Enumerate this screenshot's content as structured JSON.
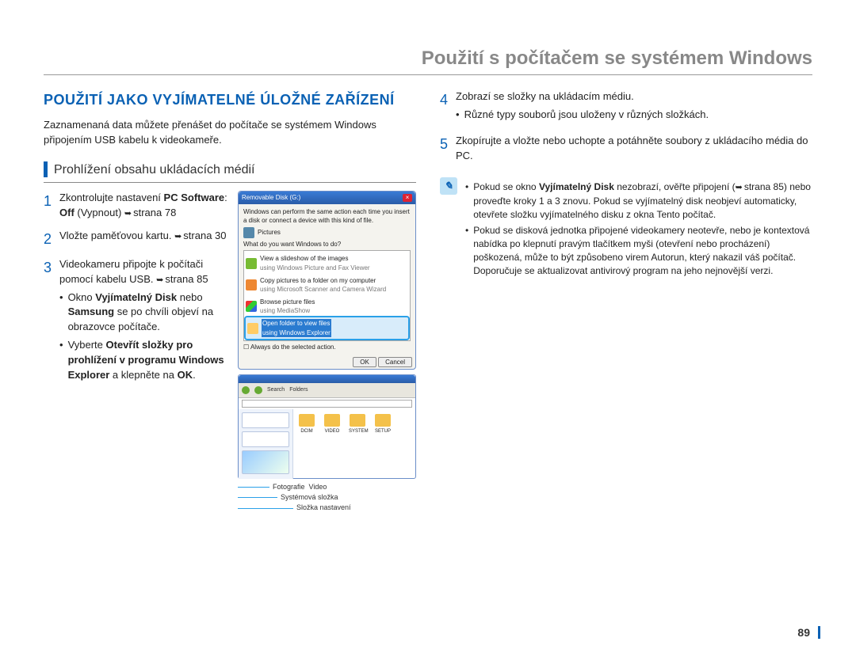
{
  "page_title": "Použití s počítačem se systémem Windows",
  "section_heading": "POUŽITÍ JAKO VYJÍMATELNÉ ÚLOŽNÉ ZAŘÍZENÍ",
  "intro": "Zaznamenaná data můžete přenášet do počítače se systémem Windows připojením USB kabelu k videokameře.",
  "sub_heading": "Prohlížení obsahu ukládacích médií",
  "steps_left": {
    "s1_a": "Zkontrolujte nastavení ",
    "s1_b": "PC Software",
    "s1_c": ": ",
    "s1_d": "Off",
    "s1_e": " (Vypnout) ",
    "s1_ref": "strana 78",
    "s2_a": "Vložte paměťovou kartu. ",
    "s2_ref": "strana 30",
    "s3_a": "Videokameru připojte k počítači pomocí kabelu USB. ",
    "s3_ref": "strana 85",
    "s3_b1_a": "Okno ",
    "s3_b1_b": "Vyjímatelný Disk",
    "s3_b1_c": " nebo ",
    "s3_b1_d": "Samsung",
    "s3_b1_e": " se po chvíli objeví na obrazovce počítače.",
    "s3_b2_a": "Vyberte ",
    "s3_b2_b": "Otevřít složky pro prohlížení v programu Windows Explorer",
    "s3_b2_c": " a klepněte na ",
    "s3_b2_d": "OK",
    "s3_b2_e": "."
  },
  "dialog": {
    "title": "Removable Disk (G:)",
    "info1": "Windows can perform the same action each time you insert a disk or connect a device with this kind of file.",
    "pic_label": "Pictures",
    "prompt": "What do you want Windows to do?",
    "opt1_a": "View a slideshow of the images",
    "opt1_b": "using Windows Picture and Fax Viewer",
    "opt2_a": "Copy pictures to a folder on my computer",
    "opt2_b": "using Microsoft Scanner and Camera Wizard",
    "opt3_a": "Browse picture files",
    "opt3_b": "using MediaShow",
    "opt4_a": "Open folder to view files",
    "opt4_b": "using Windows Explorer",
    "check": "Always do the selected action.",
    "ok": "OK",
    "cancel": "Cancel"
  },
  "explorer": {
    "toolbar_search": "Search",
    "toolbar_folders": "Folders",
    "folders": [
      "DCIM",
      "VIDEO",
      "SYSTEM",
      "SETUP"
    ]
  },
  "callouts": {
    "c1": "Fotografie",
    "c2": "Video",
    "c3": "Systémová složka",
    "c4": "Složka nastavení"
  },
  "steps_right": {
    "s4_a": "Zobrazí se složky na ukládacím médiu.",
    "s4_b1": "Různé typy souborů jsou uloženy v různých složkách.",
    "s5_a": "Zkopírujte a vložte nebo uchopte a potáhněte soubory z ukládacího média do PC."
  },
  "note": {
    "n1_a": "Pokud se okno ",
    "n1_b": "Vyjímatelný Disk",
    "n1_c": " nezobrazí, ověřte připojení (",
    "n1_ref": "strana 85",
    "n1_d": ") nebo proveďte kroky 1 a 3 znovu. Pokud se vyjímatelný disk neobjeví automaticky, otevřete složku vyjímatelného disku z okna Tento počítač.",
    "n2": "Pokud se disková jednotka připojené videokamery neotevře, nebo je kontextová nabídka po klepnutí pravým tlačítkem myši (otevření nebo procházení) poškozená, může to být způsobeno virem Autorun, který nakazil váš počítač. Doporučuje se aktualizovat antivirový program na jeho nejnovější verzi."
  },
  "page_number": "89"
}
